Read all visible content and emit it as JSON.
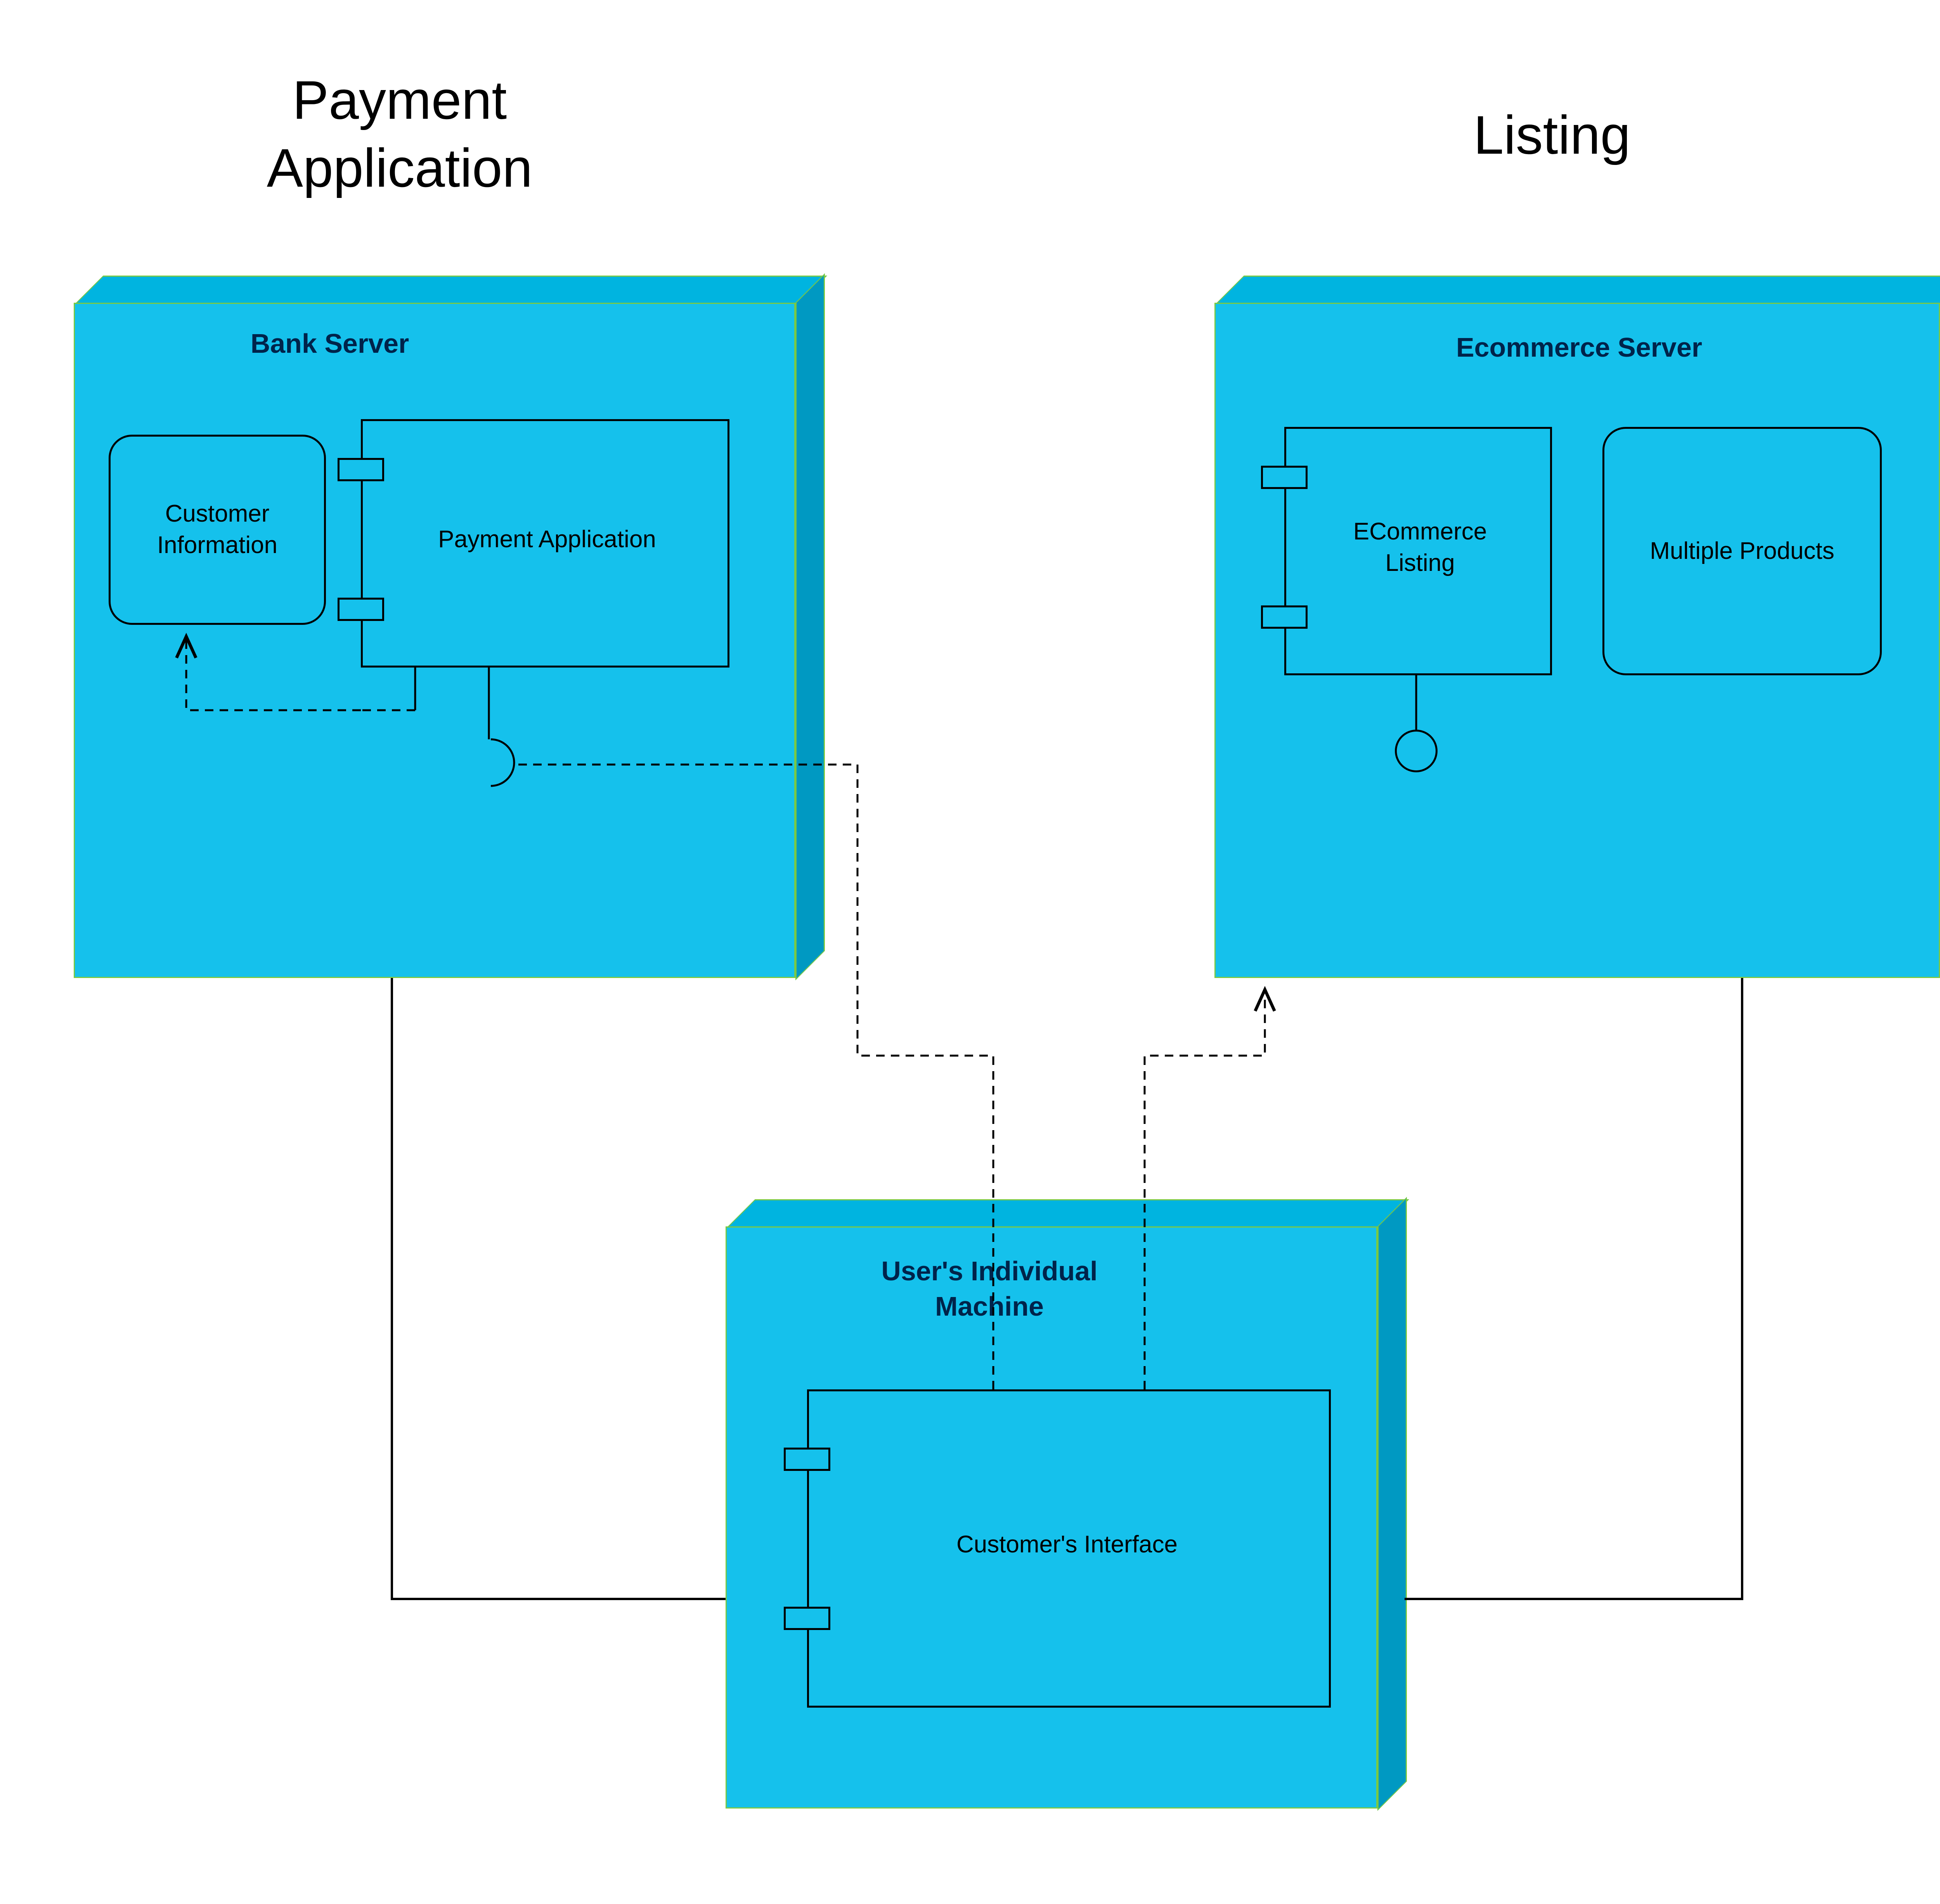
{
  "titles": {
    "payment_app": "Payment\nApplication",
    "listing": "Listing"
  },
  "nodes": {
    "bank_server": {
      "title": "Bank Server",
      "customer_info": "Customer\nInformation",
      "payment_app": "Payment Application"
    },
    "ecommerce_server": {
      "title": "Ecommerce Server",
      "listing": "ECommerce\nListing",
      "products": "Multiple Products"
    },
    "user_machine": {
      "title": "User's Individual\nMachine",
      "interface": "Customer's Interface"
    }
  }
}
